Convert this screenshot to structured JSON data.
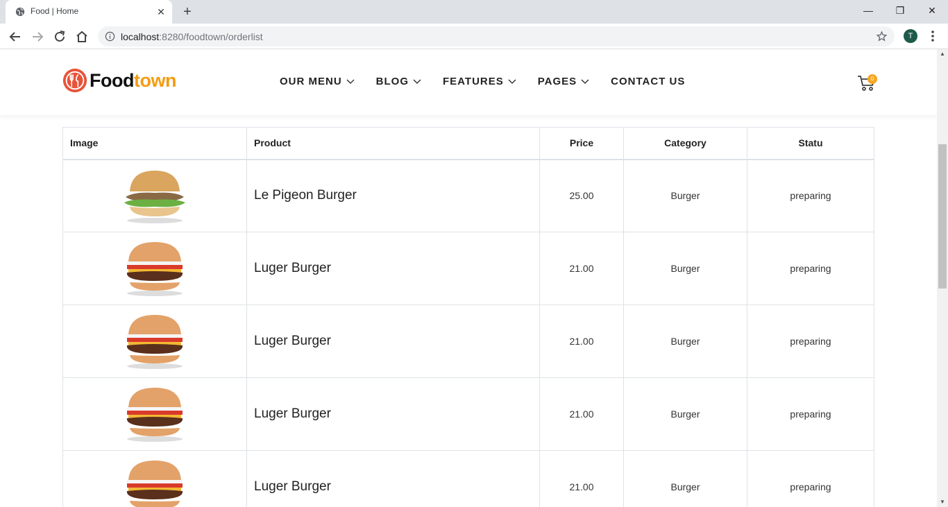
{
  "browser": {
    "tab_title": "Food | Home",
    "url_host": "localhost",
    "url_rest": ":8280/foodtown/orderlist",
    "profile_initial": "T"
  },
  "site": {
    "logo_part1": "Food",
    "logo_part2": "town",
    "nav": [
      "OUR MENU",
      "BLOG",
      "FEATURES",
      "PAGES",
      "CONTACT US"
    ],
    "cart_count": "0",
    "accent_color": "#f39c12"
  },
  "table": {
    "headers": [
      "Image",
      "Product",
      "Price",
      "Category",
      "Statu"
    ],
    "rows": [
      {
        "image": "pigeon-burger-icon",
        "product": "Le Pigeon Burger",
        "price": "25.00",
        "category": "Burger",
        "status": "preparing"
      },
      {
        "image": "luger-burger-icon",
        "product": "Luger Burger",
        "price": "21.00",
        "category": "Burger",
        "status": "preparing"
      },
      {
        "image": "luger-burger-icon",
        "product": "Luger Burger",
        "price": "21.00",
        "category": "Burger",
        "status": "preparing"
      },
      {
        "image": "luger-burger-icon",
        "product": "Luger Burger",
        "price": "21.00",
        "category": "Burger",
        "status": "preparing"
      },
      {
        "image": "luger-burger-icon",
        "product": "Luger Burger",
        "price": "21.00",
        "category": "Burger",
        "status": "preparing"
      }
    ]
  }
}
